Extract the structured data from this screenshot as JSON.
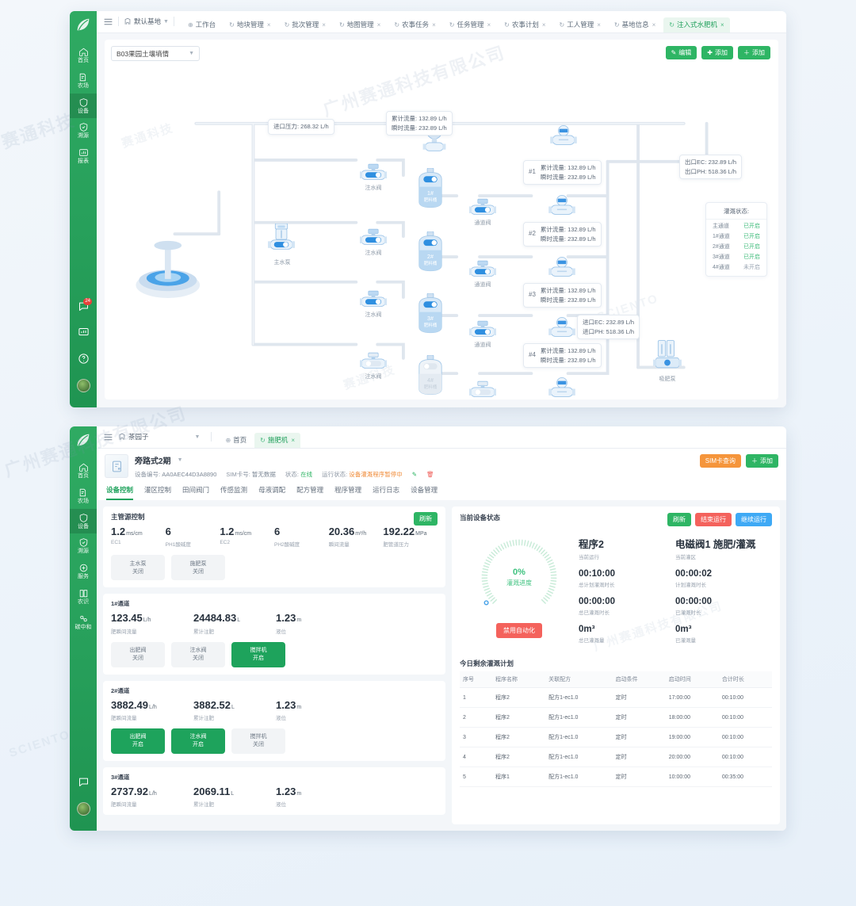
{
  "colors": {
    "brand": "#22a35e",
    "green": "#2eb564",
    "orange": "#f5953b",
    "red": "#f4625c",
    "blue": "#3ea9f5",
    "on": "#3cbb79"
  },
  "watermarks": {
    "w1": "广州赛通科技有限公司",
    "w2": "SCIENTO",
    "w3": "赛通科技"
  },
  "sidebar": {
    "items": [
      {
        "label": "首页",
        "icon": "home-icon",
        "active": false
      },
      {
        "label": "农场",
        "icon": "farm-icon",
        "active": false
      },
      {
        "label": "设备",
        "icon": "device-icon",
        "active": true
      },
      {
        "label": "溯源",
        "icon": "trace-icon",
        "active": false
      },
      {
        "label": "报表",
        "icon": "report-icon",
        "active": false
      }
    ],
    "items_bottom": [
      {
        "label": "首页",
        "icon": "home-icon",
        "active": false
      },
      {
        "label": "农场",
        "icon": "farm-icon",
        "active": false
      },
      {
        "label": "设备",
        "icon": "device-icon",
        "active": true
      },
      {
        "label": "溯源",
        "icon": "trace-icon",
        "active": false
      },
      {
        "label": "服务",
        "icon": "service-icon",
        "active": false
      },
      {
        "label": "农识",
        "icon": "knowledge-icon",
        "active": false
      },
      {
        "label": "碳中和",
        "icon": "carbon-icon",
        "active": false
      }
    ],
    "chat_badge": "24"
  },
  "top_window": {
    "topbar": {
      "base_name": "默认基地",
      "tabs": [
        {
          "label": "工作台",
          "closable": false,
          "active": false
        },
        {
          "label": "地块管理",
          "closable": true,
          "active": false
        },
        {
          "label": "批次管理",
          "closable": true,
          "active": false
        },
        {
          "label": "地图管理",
          "closable": true,
          "active": false
        },
        {
          "label": "农事任务",
          "closable": true,
          "active": false
        },
        {
          "label": "任务管理",
          "closable": true,
          "active": false
        },
        {
          "label": "农事计划",
          "closable": true,
          "active": false
        },
        {
          "label": "工人管理",
          "closable": true,
          "active": false
        },
        {
          "label": "基地信息",
          "closable": true,
          "active": false
        },
        {
          "label": "注入式水肥机",
          "closable": true,
          "active": true
        }
      ]
    },
    "selector": {
      "value": "B03果园土壤墒情"
    },
    "actions": [
      {
        "label": "编辑",
        "icon": "pencil-icon",
        "style": "green"
      },
      {
        "label": "添加",
        "icon": "plus-circle-icon",
        "style": "green"
      },
      {
        "label": "添加",
        "icon": "plus-icon",
        "style": "green"
      }
    ],
    "bubbles": {
      "inlet_pressure": "进口压力: 268.32 L/h",
      "main_flow": {
        "line1": "累计流量: 132.89 L/h",
        "line2": "瞬时流量: 232.89 L/h"
      },
      "outlet_ec": "出口EC: 232.89 L/h",
      "outlet_ph": "出口PH: 518.36 L/h",
      "inlet_ec": "进口EC: 232.89 L/h",
      "inlet_ph": "进口PH: 518.36 L/h",
      "channels": [
        {
          "idx": "#1",
          "line1": "累计流量: 132.89 L/h",
          "line2": "瞬时流量: 232.89 L/h"
        },
        {
          "idx": "#2",
          "line1": "累计流量: 132.89 L/h",
          "line2": "瞬时流量: 232.89 L/h"
        },
        {
          "idx": "#3",
          "line1": "累计流量: 132.89 L/h",
          "line2": "瞬时流量: 232.89 L/h"
        },
        {
          "idx": "#4",
          "line1": "累计流量: 132.89 L/h",
          "line2": "瞬时流量: 232.89 L/h"
        }
      ]
    },
    "node_labels": {
      "main_pump": "主水泵",
      "suck_pump": "吸肥泵",
      "inject_valve": "注水阀",
      "channel_valve": "通道阀",
      "tanks": [
        "1#肥料桶",
        "2#肥料桶",
        "3#肥料桶",
        "4#肥料桶"
      ]
    },
    "status_card": {
      "title": "灌溉状态:",
      "rows": [
        {
          "name": "主通道",
          "value": "已开启",
          "on": true
        },
        {
          "name": "1#通道",
          "value": "已开启",
          "on": true
        },
        {
          "name": "2#通道",
          "value": "已开启",
          "on": true
        },
        {
          "name": "3#通道",
          "value": "已开启",
          "on": true
        },
        {
          "name": "4#通道",
          "value": "未开启",
          "on": false
        }
      ]
    }
  },
  "bottom_window": {
    "topbar": {
      "base_name": "茶园子",
      "tabs": [
        {
          "label": "首页",
          "closable": false,
          "active": false
        },
        {
          "label": "施肥机",
          "closable": true,
          "active": true
        }
      ]
    },
    "device": {
      "name": "旁路式2期",
      "fields": [
        {
          "key": "设备编号:",
          "value": "AA0AEC44D3A8890",
          "style": "normal"
        },
        {
          "key": "SIM卡号:",
          "value": "暂无数据",
          "style": "normal"
        },
        {
          "key": "状态:",
          "value": "在线",
          "style": "on"
        },
        {
          "key": "运行状态:",
          "value": "设备灌溉程序暂停中",
          "style": "warn"
        }
      ],
      "actions": [
        {
          "label": "SIM卡查询",
          "style": "orange"
        },
        {
          "label": "添加",
          "icon": "plus-icon",
          "style": "green"
        }
      ]
    },
    "subtabs": [
      {
        "label": "设备控制",
        "active": true
      },
      {
        "label": "灌区控制",
        "active": false
      },
      {
        "label": "田间阀门",
        "active": false
      },
      {
        "label": "传感监测",
        "active": false
      },
      {
        "label": "母液调配",
        "active": false
      },
      {
        "label": "配方管理",
        "active": false
      },
      {
        "label": "程序管理",
        "active": false
      },
      {
        "label": "运行日志",
        "active": false
      },
      {
        "label": "设备管理",
        "active": false
      }
    ],
    "main_card": {
      "title": "主管源控制",
      "refresh_label": "刷新",
      "metrics": [
        {
          "value": "1.2",
          "unit": "ms/cm",
          "label": "EC1"
        },
        {
          "value": "6",
          "unit": "",
          "label": "PH1酸碱度"
        },
        {
          "value": "1.2",
          "unit": "ms/cm",
          "label": "EC2"
        },
        {
          "value": "6",
          "unit": "",
          "label": "PH2酸碱度"
        },
        {
          "value": "20.36",
          "unit": "m³/h",
          "label": "瞬间流量"
        },
        {
          "value": "192.22",
          "unit": "MPa",
          "label": "肥管道压力"
        }
      ],
      "controls": [
        {
          "name": "主水泵",
          "state": "关闭",
          "on": false
        },
        {
          "name": "施肥泵",
          "state": "关闭",
          "on": false
        }
      ]
    },
    "channels": [
      {
        "title": "1#通道",
        "metrics": [
          {
            "value": "123.45",
            "unit": "L/h",
            "label": "肥瞬间流量"
          },
          {
            "value": "24484.83",
            "unit": "L",
            "label": "累计注肥"
          },
          {
            "value": "1.23",
            "unit": "m",
            "label": "液位"
          }
        ],
        "controls": [
          {
            "name": "出肥阀",
            "state": "关闭",
            "on": false
          },
          {
            "name": "注水阀",
            "state": "关闭",
            "on": false
          },
          {
            "name": "搅拌机",
            "state": "开启",
            "on": true
          }
        ]
      },
      {
        "title": "2#通道",
        "metrics": [
          {
            "value": "3882.49",
            "unit": "L/h",
            "label": "肥瞬间流量"
          },
          {
            "value": "3882.52",
            "unit": "L",
            "label": "累计注肥"
          },
          {
            "value": "1.23",
            "unit": "m",
            "label": "液位"
          }
        ],
        "controls": [
          {
            "name": "出肥阀",
            "state": "开启",
            "on": true
          },
          {
            "name": "注水阀",
            "state": "开启",
            "on": true
          },
          {
            "name": "搅拌机",
            "state": "关闭",
            "on": false
          }
        ]
      },
      {
        "title": "3#通道",
        "metrics": [
          {
            "value": "2737.92",
            "unit": "L/h",
            "label": "肥瞬间流量"
          },
          {
            "value": "2069.11",
            "unit": "L",
            "label": "累计注肥"
          },
          {
            "value": "1.23",
            "unit": "m",
            "label": "液位"
          }
        ],
        "controls": []
      }
    ],
    "status_panel": {
      "title": "当前设备状态",
      "actions": [
        {
          "label": "刷新",
          "style": "green"
        },
        {
          "label": "结束运行",
          "style": "red"
        },
        {
          "label": "继续运行",
          "style": "blue"
        }
      ],
      "gauge": {
        "percent": "0%",
        "label": "灌溉进度",
        "value": 0
      },
      "automation_btn": "禁用自动化",
      "col_left": [
        {
          "value": "程序2",
          "label": "当前运行",
          "big": true
        },
        {
          "value": "00:10:00",
          "label": "总计划灌溉时长"
        },
        {
          "value": "00:00:00",
          "label": "总已灌溉时长"
        },
        {
          "value": "0m³",
          "label": "总已灌溉量"
        }
      ],
      "col_right": [
        {
          "value": "电磁阀1 施肥/灌溉",
          "label": "当前灌区",
          "big": true
        },
        {
          "value": "00:00:02",
          "label": "计划灌溉时长"
        },
        {
          "value": "00:00:00",
          "label": "已灌溉时长"
        },
        {
          "value": "0m³",
          "label": "已灌溉量"
        }
      ]
    },
    "plan": {
      "title": "今日剩余灌溉计划",
      "columns": [
        "序号",
        "程序名称",
        "关联配方",
        "启动条件",
        "启动时间",
        "合计时长"
      ],
      "rows": [
        [
          "1",
          "程序2",
          "配方1-ec1.0",
          "定时",
          "17:00:00",
          "00:10:00"
        ],
        [
          "2",
          "程序2",
          "配方1-ec1.0",
          "定时",
          "18:00:00",
          "00:10:00"
        ],
        [
          "3",
          "程序2",
          "配方1-ec1.0",
          "定时",
          "19:00:00",
          "00:10:00"
        ],
        [
          "4",
          "程序2",
          "配方1-ec1.0",
          "定时",
          "20:00:00",
          "00:10:00"
        ],
        [
          "5",
          "程序1",
          "配方1-ec1.0",
          "定时",
          "10:00:00",
          "00:35:00"
        ]
      ]
    }
  }
}
